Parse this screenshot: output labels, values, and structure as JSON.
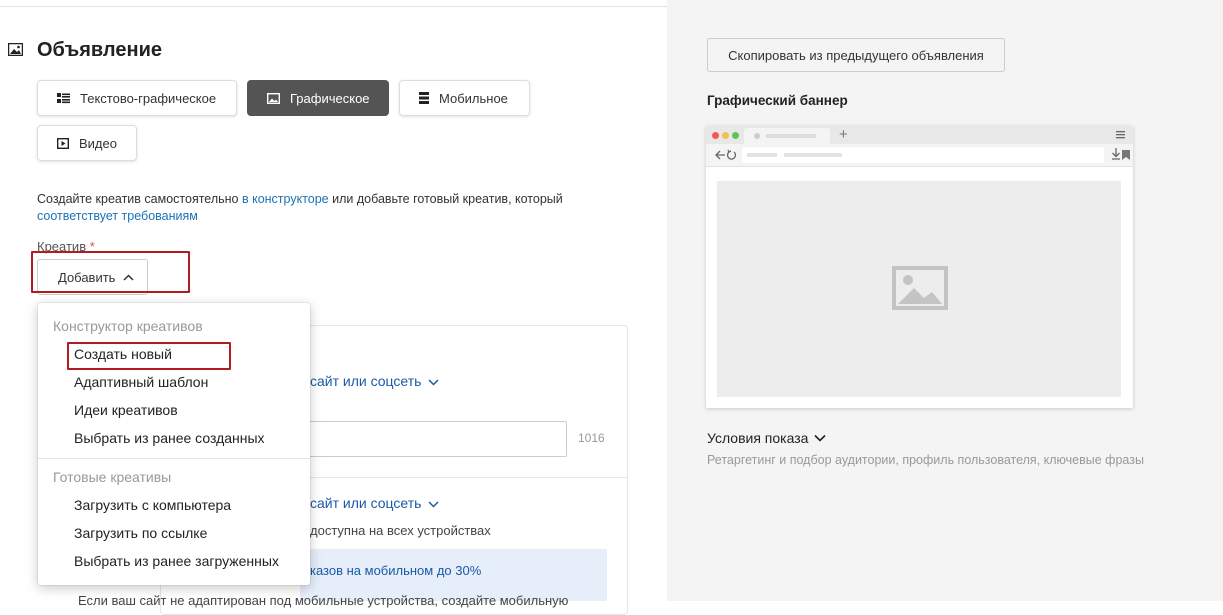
{
  "section": {
    "title": "Объявление",
    "icon": "image-icon"
  },
  "ad_types": [
    {
      "label": "Текстово-графическое",
      "icon": "text-image-icon",
      "active": false
    },
    {
      "label": "Графическое",
      "icon": "image-icon",
      "active": true
    },
    {
      "label": "Мобильное",
      "icon": "mobile-icon",
      "active": false
    },
    {
      "label": "Видео",
      "icon": "video-icon",
      "active": false
    }
  ],
  "hint": {
    "part1": "Создайте креатив самостоятельно ",
    "link1": "в конструкторе",
    "part2": " или добавьте готовый креатив, который ",
    "link2": "соответствует требованиям"
  },
  "creative": {
    "label": "Креатив",
    "required_mark": "*",
    "add_button": "Добавить"
  },
  "dropdown": {
    "group1": "Конструктор креативов",
    "group1_items": [
      "Создать новый",
      "Адаптивный шаблон",
      "Идеи креативов",
      "Выбрать из ранее созданных"
    ],
    "group2": "Готовые креативы",
    "group2_items": [
      "Загрузить с компьютера",
      "Загрузить по ссылке",
      "Выбрать из ранее загруженных"
    ]
  },
  "background": {
    "link1": "сайт или соцсеть",
    "counter": "1016",
    "link2": "сайт или соцсеть",
    "text1": "доступна на всех устройствах",
    "notice": "казов на мобильном до 30%",
    "cut_text": "Если ваш сайт не адаптирован под мобильные устройства, создайте мобильную"
  },
  "right": {
    "copy_button": "Скопировать из предыдущего объявления",
    "banner_title": "Графический баннер",
    "conditions": "Условия показа",
    "conditions_sub": "Ретаргетинг и подбор аудитории, профиль пользователя, ключевые фразы"
  },
  "colors": {
    "accent_link": "#1a73b7",
    "active_tab": "#545454",
    "highlight": "#b01c22",
    "required": "#e04b4b"
  }
}
